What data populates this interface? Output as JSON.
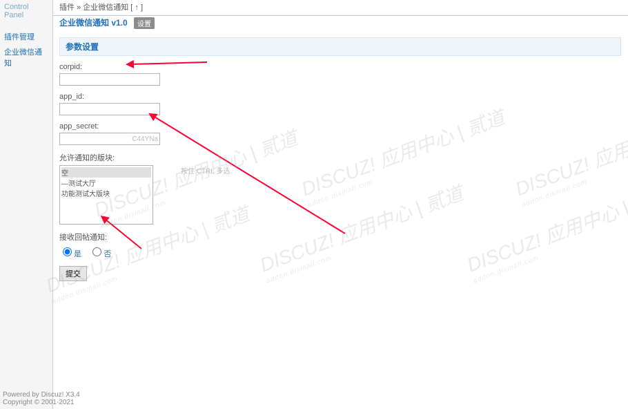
{
  "sidebar": {
    "title": "Control Panel",
    "items": [
      {
        "label": "插件管理"
      },
      {
        "label": "企业微信通知"
      }
    ]
  },
  "breadcrumb": "插件 » 企业微信通知  [ ↑ ]",
  "plugin": {
    "name": "企业微信通知 v1.0",
    "badge": "设置"
  },
  "section": "参数设置",
  "form": {
    "corpid": {
      "label": "corpid:",
      "value": ""
    },
    "app_id": {
      "label": "app_id:",
      "value": ""
    },
    "app_secret": {
      "label": "app_secret:",
      "value": "C44YNa"
    },
    "boards": {
      "label": "允许通知的版块:",
      "hint": "按住 CTRL 多选",
      "options": [
        "空",
        "—测试大厅",
        "    功能测试大版块"
      ]
    },
    "reply_notify": {
      "label": "接收回帖通知:",
      "yes": "是",
      "no": "否",
      "selected": "yes"
    },
    "submit": "提交"
  },
  "footer": {
    "line1": "Powered by Discuz! X3.4",
    "line2": "Copyright © 2001-2021"
  },
  "watermark": {
    "main": "DISCUZ! 应用中心 | 贰道",
    "sub": "addon.dismall.com"
  }
}
